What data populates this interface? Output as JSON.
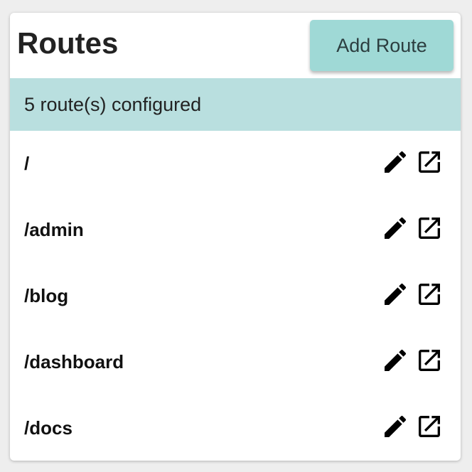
{
  "header": {
    "title": "Routes",
    "add_button_label": "Add Route"
  },
  "status": {
    "text": "5 route(s) configured"
  },
  "routes": [
    {
      "path": "/",
      "actions": [
        "pencil-icon",
        "open-in-new-icon"
      ]
    },
    {
      "path": "/admin",
      "actions": [
        "pencil-icon",
        "open-in-new-icon"
      ]
    },
    {
      "path": "/blog",
      "actions": [
        "pencil-icon",
        "open-in-new-icon"
      ]
    },
    {
      "path": "/dashboard",
      "actions": [
        "pencil-icon",
        "open-in-new-icon"
      ]
    },
    {
      "path": "/docs",
      "actions": [
        "pencil-icon",
        "open-in-new-icon"
      ]
    }
  ],
  "colors": {
    "accent_button": "#9fd9d6",
    "status_bar": "#b9dfdf",
    "background": "#eeeeee"
  }
}
